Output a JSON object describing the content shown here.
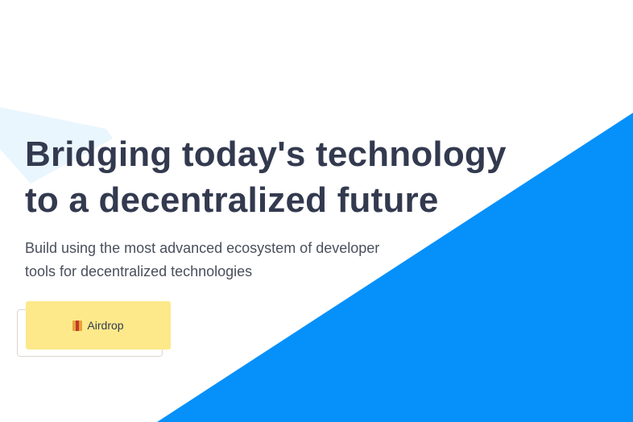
{
  "hero": {
    "title_line1": "Bridging today's technology",
    "title_line2": "to a decentralized future",
    "subtitle_line1": "Build using the most advanced ecosystem of developer",
    "subtitle_line2": "tools for decentralized technologies",
    "airdrop_button": {
      "label": "Airdrop",
      "icon": "gift-icon"
    }
  },
  "colors": {
    "accent_blue": "#0590fa",
    "light_blue": "#eaf6fd",
    "button_yellow": "#fde98a",
    "heading": "#333a4f"
  }
}
